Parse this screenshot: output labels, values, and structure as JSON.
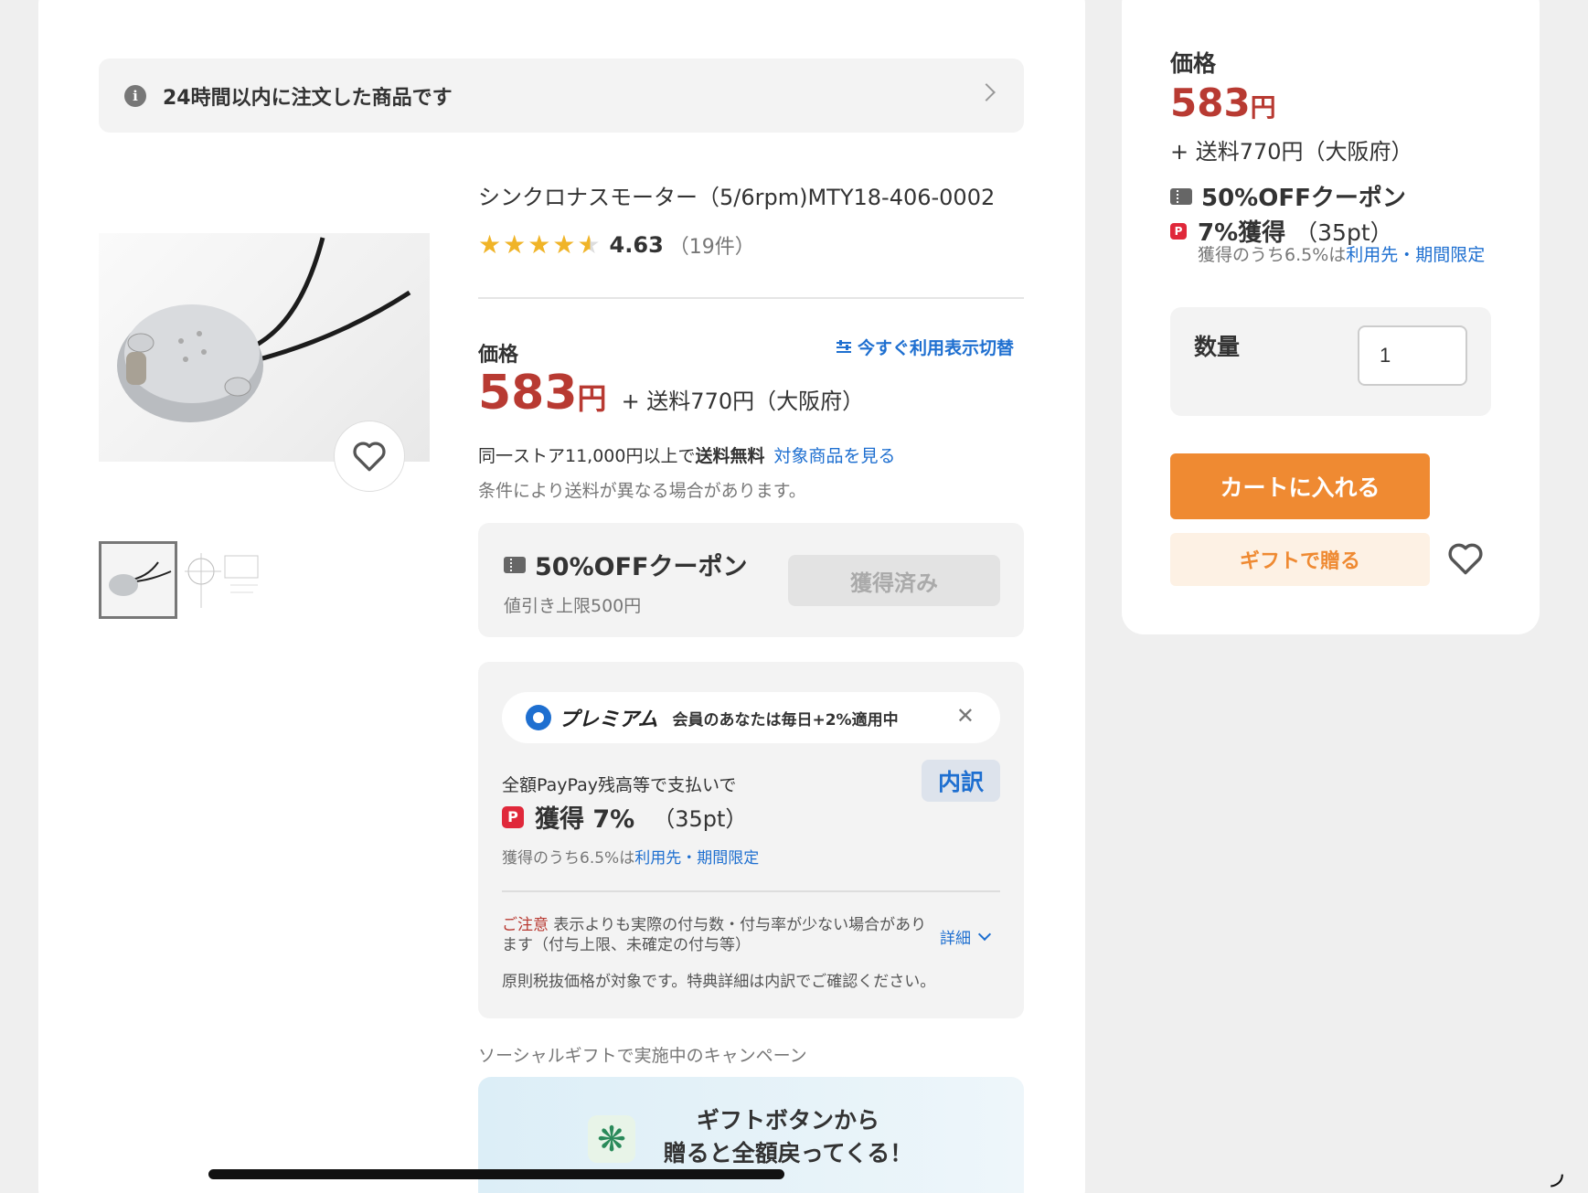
{
  "notice": {
    "text": "24時間以内に注文した商品です",
    "icon": "info-icon"
  },
  "product": {
    "title": "シンクロナスモーター（5/6rpm)MTY18-406-0002",
    "rating": {
      "value": "4.63",
      "count": "（19件）",
      "stars": 4.63
    },
    "price_label": "価格",
    "toggle_label": "今すぐ利用表示切替",
    "price": "583",
    "yen": "円",
    "shipping": "+ 送料770円（大阪府）",
    "free_ship_prefix": "同一ストア11,000円以上で",
    "free_ship_bold": "送料無料",
    "free_ship_link": "対象商品を見る",
    "ship_note": "条件により送料が異なる場合があります。"
  },
  "coupon": {
    "title": "50%OFFクーポン",
    "sub": "値引き上限500円",
    "button": "獲得済み"
  },
  "paypay": {
    "premium_label": "プレミアム",
    "premium_desc": "会員のあなたは毎日+2%適用中",
    "close": "✕",
    "line1": "全額PayPay残高等で支払いで",
    "breakdown": "内訳",
    "earn": "獲得 7%",
    "earn_pt": "（35pt）",
    "limit_prefix": "獲得のうち6.5%は",
    "limit_link": "利用先・期間限定",
    "caution_label": "ご注意",
    "caution_text": " 表示よりも実際の付与数・付与率が少ない場合があります（付与上限、未確定の付与等）",
    "detail": "詳細",
    "tax_note": "原則税抜価格が対象です。特典詳細は内訳でご確認ください。"
  },
  "social": {
    "label": "ソーシャルギフトで実施中のキャンペーン",
    "banner_line1": "ギフトボタンから",
    "banner_line2": "贈ると全額戻ってくる！"
  },
  "side": {
    "price_label": "価格",
    "price": "583",
    "yen": "円",
    "shipping": "+ 送料770円（大阪府）",
    "coupon": "50%OFFクーポン",
    "pp_earn": "7%獲得",
    "pp_pt": "（35pt）",
    "limit_prefix": "獲得のうち6.5%は",
    "limit_link": "利用先・期間限定",
    "qty_label": "数量",
    "qty_value": "1",
    "cart": "カートに入れる",
    "gift": "ギフトで贈る"
  },
  "colors": {
    "accent": "#ef8a32",
    "price": "#b83a32",
    "link": "#1e6fd0"
  }
}
